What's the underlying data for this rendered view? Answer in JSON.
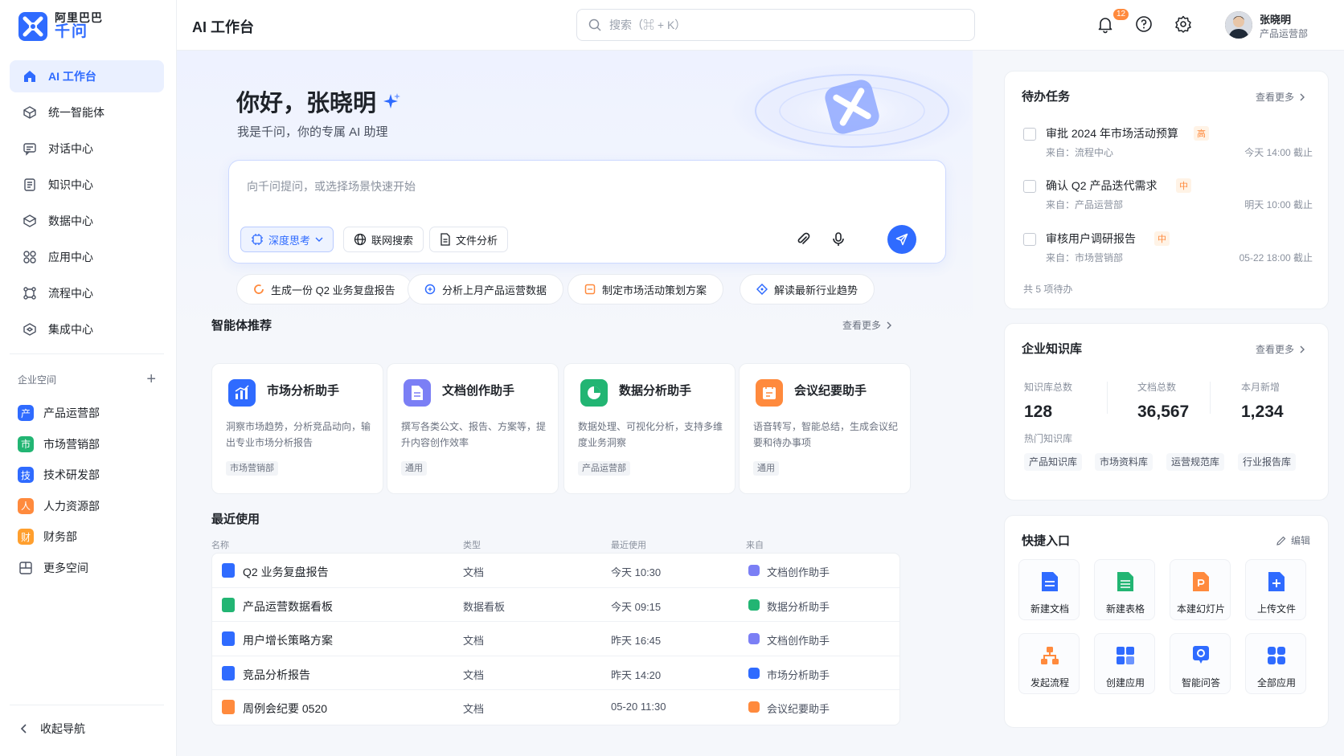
{
  "brand": {
    "line1": "阿里巴巴",
    "line2": "千问",
    "accent": "#2f6bff"
  },
  "header": {
    "title": "AI 工作台",
    "search_placeholder": "搜索（⌘ + K）",
    "notification_count": "12",
    "user_name": "张晓明",
    "user_dept": "产品运营部"
  },
  "nav": {
    "items": [
      {
        "label": "AI 工作台",
        "icon": "home-icon"
      },
      {
        "label": "统一智能体",
        "icon": "cube-icon"
      },
      {
        "label": "对话中心",
        "icon": "chat-icon"
      },
      {
        "label": "知识中心",
        "icon": "book-icon"
      },
      {
        "label": "数据中心",
        "icon": "database-icon"
      },
      {
        "label": "应用中心",
        "icon": "apps-icon"
      },
      {
        "label": "流程中心",
        "icon": "flow-icon"
      },
      {
        "label": "集成中心",
        "icon": "integration-icon"
      }
    ],
    "workspace_title": "企业空间",
    "workspaces": [
      {
        "label": "产品运营部",
        "badge": "产",
        "color": "#2f6bff"
      },
      {
        "label": "市场营销部",
        "badge": "市",
        "color": "#22b573"
      },
      {
        "label": "技术研发部",
        "badge": "技",
        "color": "#2f6bff"
      },
      {
        "label": "人力资源部",
        "badge": "人",
        "color": "#ff8a3d"
      },
      {
        "label": "财务部",
        "badge": "财",
        "color": "#ff9f2e"
      },
      {
        "label": "更多空间",
        "badge": "",
        "color": ""
      }
    ],
    "collapse_label": "收起导航"
  },
  "hero": {
    "greeting": "你好，张晓明",
    "subtitle": "我是千问，你的专属 AI 助理",
    "input_placeholder": "向千问提问，或选择场景快速开始",
    "chip_deep": "深度思考",
    "chip_web": "联网搜索",
    "chip_file": "文件分析"
  },
  "suggestions": [
    "生成一份 Q2 业务复盘报告",
    "分析上月产品运营数据",
    "制定市场活动策划方案",
    "解读最新行业趋势"
  ],
  "agents": {
    "title": "智能体推荐",
    "more": "查看更多",
    "items": [
      {
        "name": "市场分析助手",
        "desc": "洞察市场趋势，分析竞品动向，输出专业市场分析报告",
        "tag": "市场营销部",
        "color": "#2f6bff"
      },
      {
        "name": "文档创作助手",
        "desc": "撰写各类公文、报告、方案等，提升内容创作效率",
        "tag": "通用",
        "color": "#7b7ff5"
      },
      {
        "name": "数据分析助手",
        "desc": "数据处理、可视化分析，支持多维度业务洞察",
        "tag": "产品运营部",
        "color": "#22b573"
      },
      {
        "name": "会议纪要助手",
        "desc": "语音转写，智能总结，生成会议纪要和待办事项",
        "tag": "通用",
        "color": "#ff8a3d"
      }
    ]
  },
  "recent": {
    "title": "最近使用",
    "columns": [
      "名称",
      "类型",
      "最近使用",
      "来自"
    ],
    "rows": [
      {
        "name": "Q2 业务复盘报告",
        "type": "文档",
        "time": "今天 10:30",
        "source": "文档创作助手",
        "color": "#2f6bff",
        "src_color": "#7b7ff5"
      },
      {
        "name": "产品运营数据看板",
        "type": "数据看板",
        "time": "今天 09:15",
        "source": "数据分析助手",
        "color": "#22b573",
        "src_color": "#22b573"
      },
      {
        "name": "用户增长策略方案",
        "type": "文档",
        "time": "昨天 16:45",
        "source": "文档创作助手",
        "color": "#2f6bff",
        "src_color": "#7b7ff5"
      },
      {
        "name": "竞品分析报告",
        "type": "文档",
        "time": "昨天 14:20",
        "source": "市场分析助手",
        "color": "#2f6bff",
        "src_color": "#2f6bff"
      },
      {
        "name": "周例会纪要 0520",
        "type": "文档",
        "time": "05-20 11:30",
        "source": "会议纪要助手",
        "color": "#ff8a3d",
        "src_color": "#ff8a3d"
      }
    ]
  },
  "todo": {
    "title": "待办任务",
    "more": "查看更多",
    "items": [
      {
        "title": "审批 2024 年市场活动预算",
        "priority": "高",
        "from": "来自：流程中心",
        "due": "今天 14:00 截止"
      },
      {
        "title": "确认 Q2 产品迭代需求",
        "priority": "中",
        "from": "来自：产品运营部",
        "due": "明天 10:00 截止"
      },
      {
        "title": "审核用户调研报告",
        "priority": "中",
        "from": "来自：市场营销部",
        "due": "05-22 18:00 截止"
      }
    ],
    "total": "共 5 项待办"
  },
  "kb": {
    "title": "企业知识库",
    "more": "查看更多",
    "stats": [
      {
        "label": "知识库总数",
        "value": "128"
      },
      {
        "label": "文档总数",
        "value": "36,567"
      },
      {
        "label": "本月新增",
        "value": "1,234"
      }
    ],
    "hot_title": "热门知识库",
    "hot": [
      "产品知识库",
      "市场资料库",
      "运营规范库",
      "行业报告库"
    ]
  },
  "quick": {
    "title": "快捷入口",
    "edit": "编辑",
    "items": [
      {
        "label": "新建文档",
        "icon": "doc-icon",
        "color": "#2f6bff"
      },
      {
        "label": "新建表格",
        "icon": "sheet-icon",
        "color": "#22b573"
      },
      {
        "label": "本建幻灯片",
        "icon": "slides-icon",
        "color": "#ff8a3d"
      },
      {
        "label": "上传文件",
        "icon": "upload-icon",
        "color": "#2f6bff"
      },
      {
        "label": "发起流程",
        "icon": "workflow-icon",
        "color": "#ff8a3d"
      },
      {
        "label": "创建应用",
        "icon": "apps-icon",
        "color": "#2f6bff"
      },
      {
        "label": "智能问答",
        "icon": "qa-icon",
        "color": "#2f6bff"
      },
      {
        "label": "全部应用",
        "icon": "all-apps-icon",
        "color": "#2f6bff"
      }
    ]
  }
}
